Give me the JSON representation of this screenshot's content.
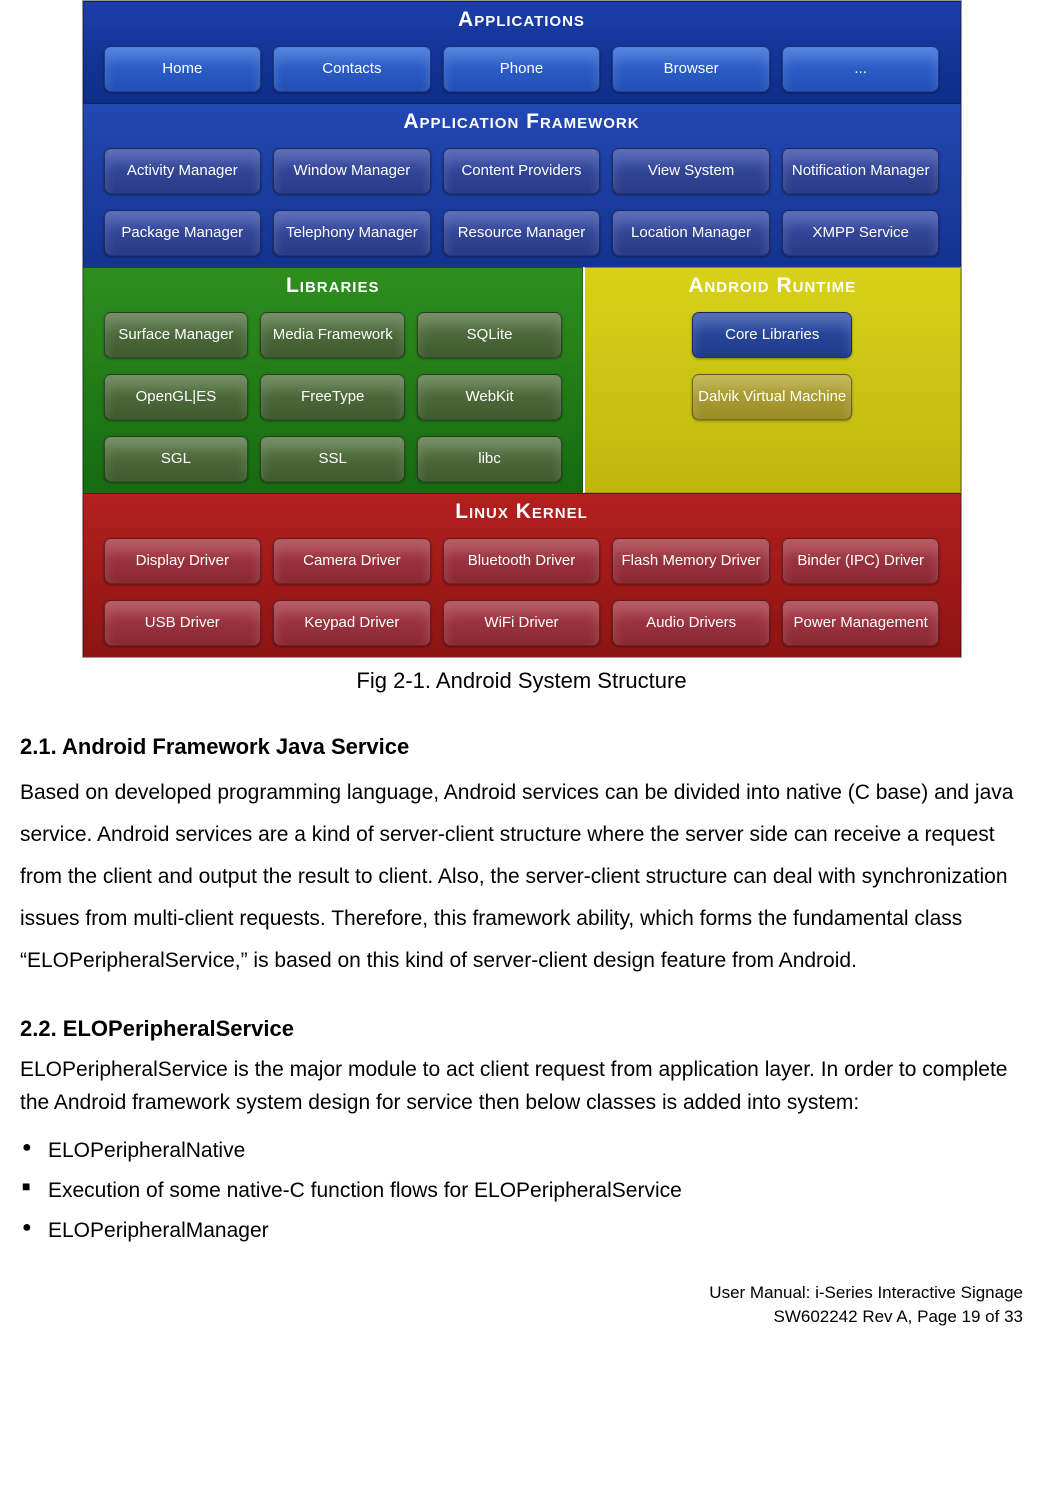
{
  "diagram": {
    "applications": {
      "title": "Applications",
      "row1": [
        "Home",
        "Contacts",
        "Phone",
        "Browser",
        "..."
      ]
    },
    "framework": {
      "title": "Application Framework",
      "row1": [
        "Activity Manager",
        "Window Manager",
        "Content Providers",
        "View System",
        "Notification Manager"
      ],
      "row2": [
        "Package Manager",
        "Telephony Manager",
        "Resource Manager",
        "Location Manager",
        "XMPP Service"
      ]
    },
    "libraries": {
      "title": "Libraries",
      "row1": [
        "Surface Manager",
        "Media Framework",
        "SQLite"
      ],
      "row2": [
        "OpenGL|ES",
        "FreeType",
        "WebKit"
      ],
      "row3": [
        "SGL",
        "SSL",
        "libc"
      ]
    },
    "runtime": {
      "title": "Android Runtime",
      "chip1": "Core Libraries",
      "chip2": "Dalvik Virtual Machine"
    },
    "kernel": {
      "title": "Linux Kernel",
      "row1": [
        "Display Driver",
        "Camera Driver",
        "Bluetooth Driver",
        "Flash Memory Driver",
        "Binder (IPC) Driver"
      ],
      "row2": [
        "USB Driver",
        "Keypad Driver",
        "WiFi Driver",
        "Audio Drivers",
        "Power Management"
      ]
    }
  },
  "caption": "Fig 2-1. Android System Structure",
  "section21": {
    "heading": "2.1. Android Framework Java Service",
    "body": "Based on developed programming language, Android services can be divided into native (C base) and java service. Android services are a kind of server-client structure where the server side can receive a request from the client and output the result to client. Also, the server-client structure can deal with synchronization issues from multi-client requests. Therefore, this framework ability, which forms the fundamental class “ELOPeripheralService,” is based on this kind of server-client design feature from Android."
  },
  "section22": {
    "heading": "2.2. ELOPeripheralService",
    "body": "ELOPeripheralService is the major module to act client request from application layer. In order to complete the Android framework system design for service then below classes is added into system:",
    "bul1": "ELOPeripheralNative",
    "bul2": "Execution of some native-C function flows for ELOPeripheralService",
    "bul3": "ELOPeripheralManager"
  },
  "footer": {
    "l1": "User Manual: i-Series Interactive Signage",
    "l2": "SW602242 Rev A, Page 19 of 33"
  }
}
